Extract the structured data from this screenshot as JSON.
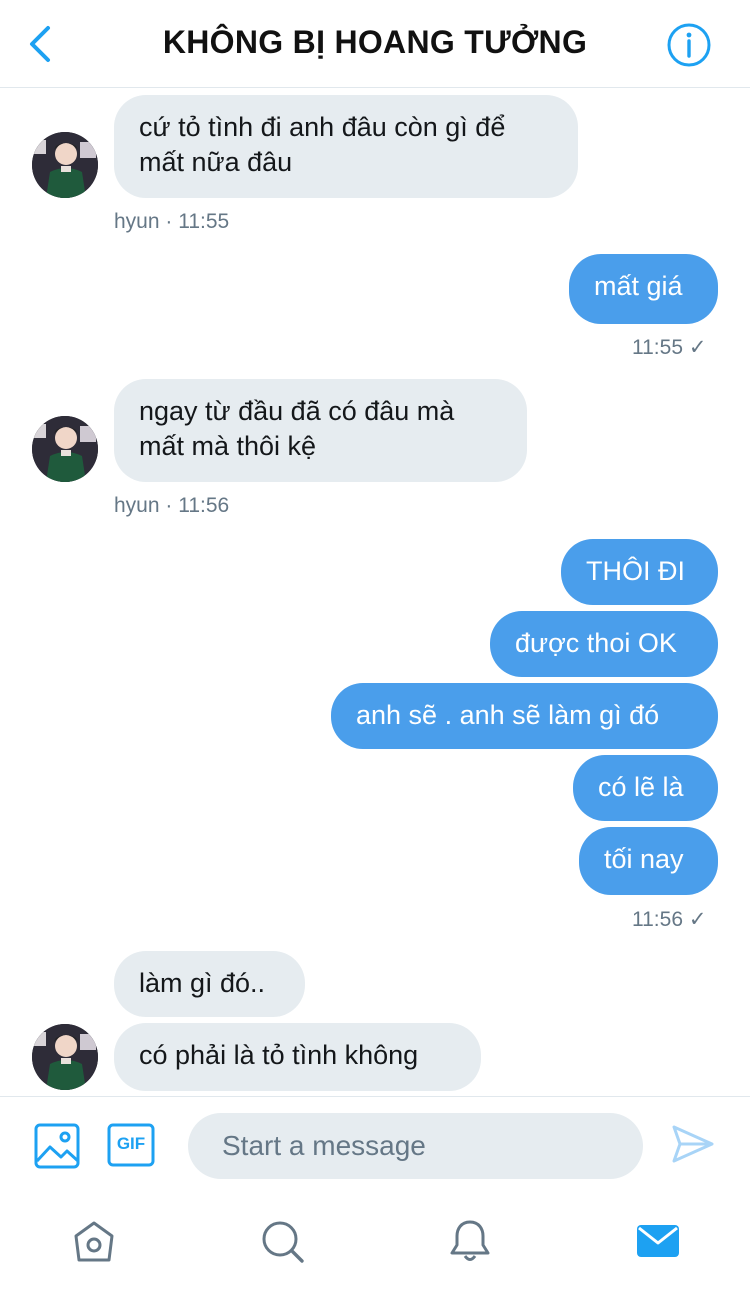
{
  "header": {
    "title": "KHÔNG BỊ HOANG TƯỞNG",
    "back_icon": "chevron-left-icon",
    "info_icon": "info-icon"
  },
  "messages": [
    {
      "side": "in",
      "lines": [
        "cứ tỏ tình đi anh đâu còn gì để",
        "mất nữa đâu"
      ],
      "meta": "hyun · 11:55"
    },
    {
      "side": "out",
      "lines": [
        "mất giá"
      ],
      "meta": "11:55 ✓"
    },
    {
      "side": "in",
      "lines": [
        "ngay từ đầu đã có đâu mà",
        "mất mà thôi kệ"
      ],
      "meta": "hyun · 11:56"
    },
    {
      "side": "out",
      "lines": [
        "THÔI ĐI"
      ]
    },
    {
      "side": "out",
      "lines": [
        "được thoi OK"
      ]
    },
    {
      "side": "out",
      "lines": [
        "anh sẽ . anh sẽ làm gì đó"
      ]
    },
    {
      "side": "out",
      "lines": [
        "có lẽ là"
      ]
    },
    {
      "side": "out",
      "lines": [
        "tối nay"
      ],
      "meta": "11:56 ✓"
    },
    {
      "side": "in",
      "lines": [
        "làm gì đó.."
      ]
    },
    {
      "side": "in",
      "lines": [
        "có phải là tỏ tình không"
      ]
    }
  ],
  "composer": {
    "placeholder": "Start a message",
    "gif_label": "GIF"
  },
  "tabs": [
    "home-icon",
    "search-icon",
    "notifications-icon",
    "messages-icon"
  ],
  "colors": {
    "accent": "#1da1f2",
    "outgoing_bubble": "#4a9eeb",
    "incoming_bubble": "#e6ecf0",
    "meta_text": "#657786"
  }
}
